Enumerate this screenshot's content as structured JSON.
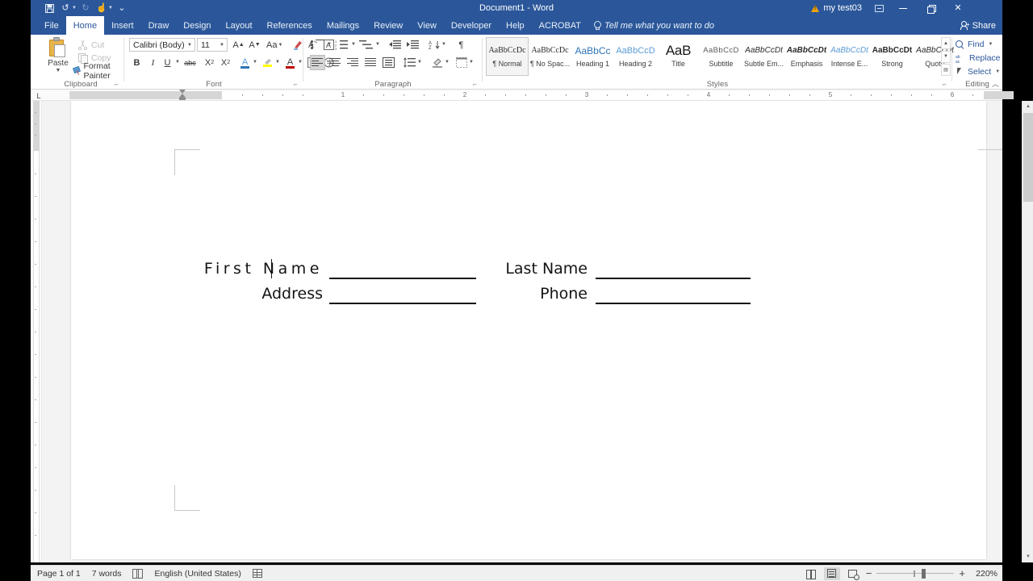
{
  "window": {
    "title": "Document1  -  Word",
    "account": "my test03",
    "account_warning_icon": "warning-triangle-icon",
    "ribbon_display_icon": "ribbon-display-options-icon",
    "minimize_icon": "minimize-icon",
    "restore_icon": "restore-icon",
    "close_icon": "close-icon",
    "share_label": "Share",
    "share_icon": "share-person-icon"
  },
  "quick_access": [
    {
      "name": "save-icon",
      "glyph": "ὋE",
      "dim": false
    },
    {
      "name": "undo-icon",
      "glyph": "↶",
      "dim": false,
      "caret": true
    },
    {
      "name": "redo-icon",
      "glyph": "↷",
      "dim": true
    },
    {
      "name": "touch-mouse-mode-icon",
      "glyph": "☝",
      "dim": false,
      "caret": true
    },
    {
      "name": "customize-qat-icon",
      "glyph": "≡",
      "dim": false
    }
  ],
  "tabs": [
    {
      "label": "File",
      "active": false
    },
    {
      "label": "Home",
      "active": true
    },
    {
      "label": "Insert",
      "active": false
    },
    {
      "label": "Draw",
      "active": false
    },
    {
      "label": "Design",
      "active": false
    },
    {
      "label": "Layout",
      "active": false
    },
    {
      "label": "References",
      "active": false
    },
    {
      "label": "Mailings",
      "active": false
    },
    {
      "label": "Review",
      "active": false
    },
    {
      "label": "View",
      "active": false
    },
    {
      "label": "Developer",
      "active": false
    },
    {
      "label": "Help",
      "active": false
    },
    {
      "label": "ACROBAT",
      "active": false
    }
  ],
  "tell_me": "Tell me what you want to do",
  "ribbon": {
    "clipboard": {
      "group_label": "Clipboard",
      "paste_label": "Paste",
      "items": [
        {
          "label": "Cut",
          "icon": "scissors-icon",
          "enabled": false
        },
        {
          "label": "Copy",
          "icon": "copy-icon",
          "enabled": false
        },
        {
          "label": "Format Painter",
          "icon": "format-painter-icon",
          "enabled": true
        }
      ]
    },
    "font": {
      "group_label": "Font",
      "font_name": "Calibri (Body)",
      "font_size": "11",
      "buttons_row1": [
        {
          "label": "A",
          "name": "grow-font-icon"
        },
        {
          "label": "A",
          "name": "shrink-font-icon"
        },
        {
          "label": "Aa",
          "name": "change-case-icon"
        },
        {
          "label": "",
          "name": "clear-formatting-icon"
        },
        {
          "label": "",
          "name": "text-highlight-icon"
        },
        {
          "label": "A",
          "name": "font-color-icon"
        }
      ],
      "buttons_row2": [
        {
          "label": "B",
          "name": "bold-button"
        },
        {
          "label": "I",
          "name": "italic-button"
        },
        {
          "label": "U",
          "name": "underline-button"
        },
        {
          "label": "abc",
          "name": "strikethrough-button"
        },
        {
          "label": "X",
          "name": "subscript-button"
        },
        {
          "label": "X",
          "name": "superscript-button"
        }
      ]
    },
    "paragraph": {
      "group_label": "Paragraph",
      "row1": [
        "bullets-icon",
        "numbering-icon",
        "multilevel-list-icon",
        "decrease-indent-icon",
        "increase-indent-icon",
        "sort-icon",
        "show-formatting-marks-icon"
      ],
      "row2": [
        "align-left-icon",
        "align-center-icon",
        "align-right-icon",
        "justify-icon",
        "line-spacing-icon",
        "shading-icon",
        "borders-icon"
      ]
    },
    "styles": {
      "group_label": "Styles",
      "items": [
        {
          "preview": "AaBbCcDc",
          "name": "¶ Normal",
          "selected": true,
          "cls": "sp-normal"
        },
        {
          "preview": "AaBbCcDc",
          "name": "¶ No Spac...",
          "selected": false,
          "cls": "sp-normal"
        },
        {
          "preview": "AaBbCc",
          "name": "Heading 1",
          "selected": false,
          "cls": "sp-h1"
        },
        {
          "preview": "AaBbCcD",
          "name": "Heading 2",
          "selected": false,
          "cls": "sp-h2"
        },
        {
          "preview": "AaB",
          "name": "Title",
          "selected": false,
          "cls": "sp-title"
        },
        {
          "preview": "AaBbCcD",
          "name": "Subtitle",
          "selected": false,
          "cls": "sp-sub"
        },
        {
          "preview": "AaBbCcDt",
          "name": "Subtle Em...",
          "selected": false,
          "cls": "sp-em"
        },
        {
          "preview": "AaBbCcDt",
          "name": "Emphasis",
          "selected": false,
          "cls": "sp-emph"
        },
        {
          "preview": "AaBbCcDt",
          "name": "Intense E...",
          "selected": false,
          "cls": "sp-int"
        },
        {
          "preview": "AaBbCcDt",
          "name": "Strong",
          "selected": false,
          "cls": "sp-strong"
        },
        {
          "preview": "AaBbCcDt",
          "name": "Quote",
          "selected": false,
          "cls": "sp-quote"
        }
      ]
    },
    "editing": {
      "group_label": "Editing",
      "items": [
        {
          "label": "Find",
          "icon": "search-icon",
          "caret": true
        },
        {
          "label": "Replace",
          "icon": "replace-icon",
          "caret": false
        },
        {
          "label": "Select",
          "icon": "select-cursor-icon",
          "caret": true
        }
      ]
    }
  },
  "ruler": {
    "tab_stop_icon": "left-tab-stop-icon",
    "numbers": [
      "1",
      "2",
      "3",
      "4",
      "5",
      "6"
    ]
  },
  "document": {
    "rows": [
      {
        "label1": "First Name",
        "spread1": true,
        "label2": "Last Name",
        "spread2": false
      },
      {
        "label1": "Address",
        "spread1": false,
        "label2": "Phone",
        "spread2": false
      }
    ]
  },
  "status_bar": {
    "page": "Page 1 of 1",
    "words": "7 words",
    "proofing_icon": "proofing-errors-icon",
    "language": "English (United States)",
    "macro_icon": "macro-recording-icon",
    "views": [
      {
        "name": "read-mode-view-button",
        "selected": false
      },
      {
        "name": "print-layout-view-button",
        "selected": true
      },
      {
        "name": "web-layout-view-button",
        "selected": false
      }
    ],
    "zoom_out_label": "−",
    "zoom_in_label": "+",
    "zoom_level": "220%"
  }
}
